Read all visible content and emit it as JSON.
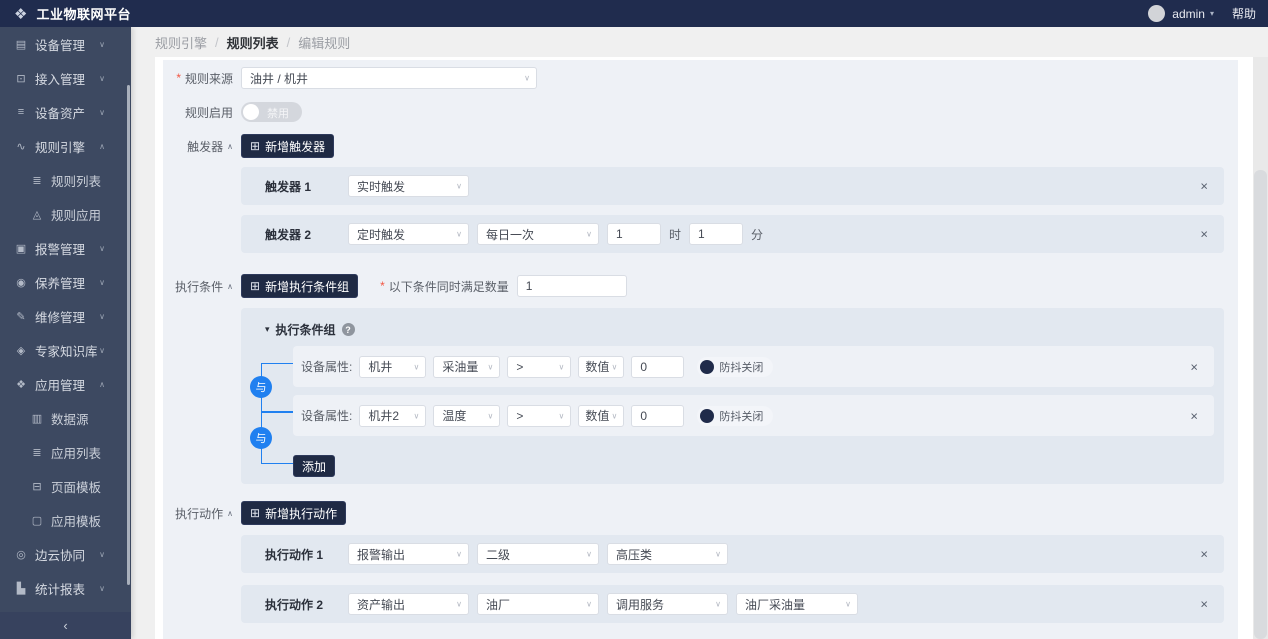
{
  "ui": {
    "required": "*",
    "close": "×",
    "select_caret": "∨",
    "section_caret": "∧",
    "group_caret": "▾",
    "collapse": "‹",
    "add_icon": "⊞",
    "help_q": "?",
    "slash": "/",
    "user_caret": "▾"
  },
  "colors": {
    "topbar": "#202c4e",
    "sidebar": "#3d4961",
    "dark_button": "#1f2a44",
    "accent_blue": "#2080f0",
    "form_bg": "#eef1f6",
    "row_bg": "#e2e8f0",
    "required_red": "#f25643"
  },
  "topbar": {
    "logo_icon": "❖",
    "title": "工业物联网平台",
    "user": "admin",
    "help": "帮助"
  },
  "sidebar": {
    "items": [
      {
        "icon": "▤",
        "label": "设备管理",
        "chev": "∨"
      },
      {
        "icon": "⊡",
        "label": "接入管理",
        "chev": "∨"
      },
      {
        "icon": "≡",
        "label": "设备资产",
        "chev": "∨"
      },
      {
        "icon": "∿",
        "label": "规则引擎",
        "chev": "∧"
      },
      {
        "icon": "≣",
        "label": "规则列表"
      },
      {
        "icon": "◬",
        "label": "规则应用"
      },
      {
        "icon": "▣",
        "label": "报警管理",
        "chev": "∨"
      },
      {
        "icon": "◉",
        "label": "保养管理",
        "chev": "∨"
      },
      {
        "icon": "✎",
        "label": "维修管理",
        "chev": "∨"
      },
      {
        "icon": "◈",
        "label": "专家知识库",
        "chev": "∨"
      },
      {
        "icon": "❖",
        "label": "应用管理",
        "chev": "∧"
      },
      {
        "icon": "▥",
        "label": "数据源"
      },
      {
        "icon": "≣",
        "label": "应用列表"
      },
      {
        "icon": "⊟",
        "label": "页面模板"
      },
      {
        "icon": "▢",
        "label": "应用模板"
      },
      {
        "icon": "◎",
        "label": "边云协同",
        "chev": "∨"
      },
      {
        "icon": "▙",
        "label": "统计报表",
        "chev": "∨"
      }
    ]
  },
  "breadcrumb": {
    "items": [
      "规则引擎",
      "规则列表",
      "编辑规则"
    ]
  },
  "form": {
    "source": {
      "label": "规则来源",
      "value": "油井 / 机井"
    },
    "enable": {
      "label": "规则启用",
      "state_label": "禁用"
    },
    "trigger": {
      "section_label": "触发器",
      "add_button": "新增触发器",
      "rows": [
        {
          "title": "触发器 1",
          "type": "实时触发"
        },
        {
          "title": "触发器 2",
          "type": "定时触发",
          "frequency": "每日一次",
          "hour": "1",
          "hour_unit": "时",
          "minute": "1",
          "minute_unit": "分"
        }
      ]
    },
    "condition": {
      "section_label": "执行条件",
      "add_button": "新增执行条件组",
      "count_label": "以下条件同时满足数量",
      "count_value": "1",
      "group": {
        "title": "执行条件组",
        "connector": "与",
        "add_row_button": "添加",
        "rows": [
          {
            "label": "设备属性:",
            "device": "机井",
            "attribute": "采油量",
            "operator": ">",
            "value_type": "数值",
            "value": "0",
            "debounce_label": "防抖关闭"
          },
          {
            "label": "设备属性:",
            "device": "机井2",
            "attribute": "温度",
            "operator": ">",
            "value_type": "数值",
            "value": "0",
            "debounce_label": "防抖关闭"
          }
        ]
      }
    },
    "action": {
      "section_label": "执行动作",
      "add_button": "新增执行动作",
      "rows": [
        {
          "title": "执行动作 1",
          "selects": [
            "报警输出",
            "二级",
            "高压类"
          ]
        },
        {
          "title": "执行动作 2",
          "selects": [
            "资产输出",
            "油厂",
            "调用服务",
            "油厂采油量"
          ]
        }
      ]
    }
  }
}
